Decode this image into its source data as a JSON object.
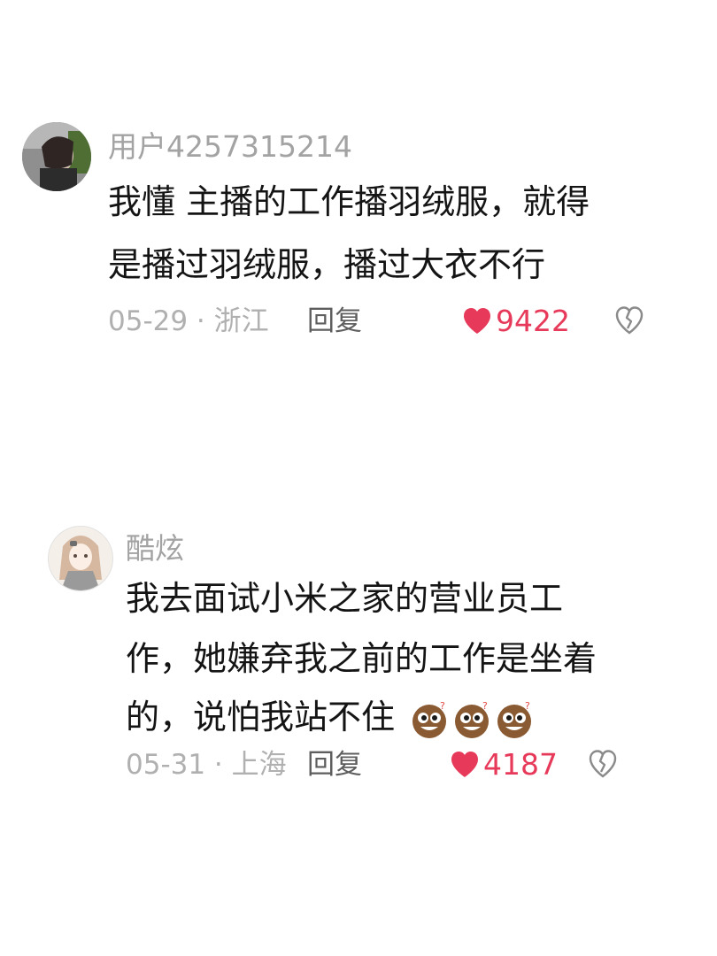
{
  "comments": [
    {
      "username": "用户4257315214",
      "lines": [
        "我懂 主播的工作播羽绒服，就得",
        "是播过羽绒服，播过大衣不行"
      ],
      "date_location": "05-29 · 浙江",
      "reply_label": "回复",
      "like_count": "9422",
      "icons": {
        "avatar": "user-photo-avatar",
        "like": "heart-icon",
        "dislike": "broken-heart-icon"
      }
    },
    {
      "username": "酷炫",
      "lines": [
        "我去面试小米之家的营业员工",
        "作，她嫌弃我之前的工作是坐着",
        "的，说怕我站不住"
      ],
      "date_location": "05-31 · 上海",
      "reply_label": "回复",
      "like_count": "4187",
      "icons": {
        "avatar": "cartoon-girl-avatar",
        "emoji": "laughing-cookie-emoji",
        "like": "heart-icon",
        "dislike": "broken-heart-icon"
      }
    }
  ],
  "colors": {
    "body_text": "#141414",
    "username": "#a3a3a3",
    "meta": "#b0b0b0",
    "reply": "#5e5e5e",
    "like": "#e73a5a"
  }
}
